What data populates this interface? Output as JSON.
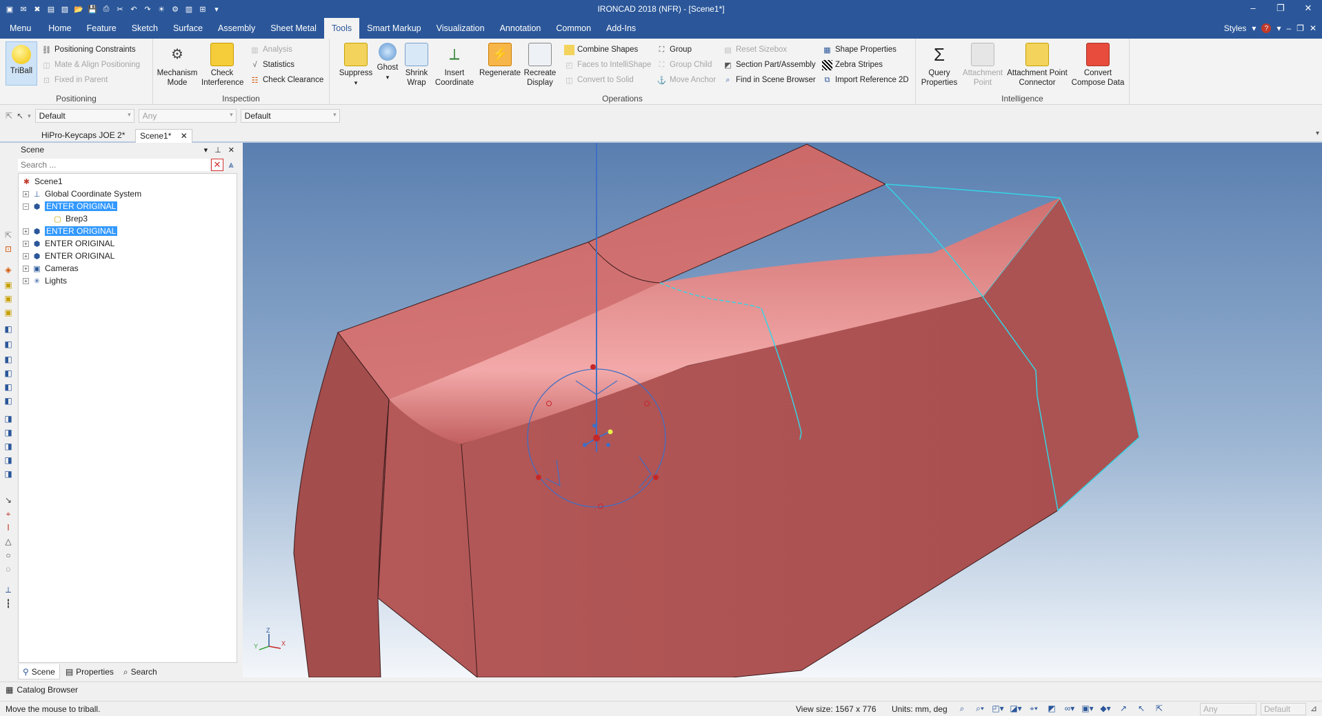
{
  "window": {
    "title": "IRONCAD 2018 (NFR) - [Scene1*]",
    "controls": [
      "–",
      "❐",
      "✕"
    ]
  },
  "quick_access": [
    "▣",
    "✉",
    "✖",
    "▤",
    "▧",
    "📂",
    "💾",
    "⎙",
    "✂",
    "↶",
    "↷",
    "☀",
    "⚙",
    "▥",
    "⊞",
    "▾"
  ],
  "ribbon_tabs": [
    "Menu",
    "Home",
    "Feature",
    "Sketch",
    "Surface",
    "Assembly",
    "Sheet Metal",
    "Tools",
    "Smart Markup",
    "Visualization",
    "Annotation",
    "Common",
    "Add-Ins"
  ],
  "active_tab": "Tools",
  "ribbon_right": {
    "styles": "Styles",
    "help": "?"
  },
  "ribbon": {
    "positioning": {
      "label": "Positioning",
      "triball": "TriBall",
      "positioning_constraints": "Positioning Constraints",
      "mate_align": "Mate & Align Positioning",
      "fixed_in_parent": "Fixed in Parent"
    },
    "inspection": {
      "label": "Inspection",
      "mechanism_mode": "Mechanism Mode",
      "check_interference": "Check Interference",
      "analysis": "Analysis",
      "statistics": "Statistics",
      "check_clearance": "Check Clearance"
    },
    "operations": {
      "label": "Operations",
      "suppress": "Suppress",
      "ghost": "Ghost",
      "shrink_wrap": "Shrink Wrap",
      "insert_coordinate": "Insert Coordinate",
      "regenerate": "Regenerate",
      "recreate_display": "Recreate Display",
      "combine_shapes": "Combine Shapes",
      "faces_to_intellishape": "Faces to IntelliShape",
      "convert_to_solid": "Convert to Solid",
      "group": "Group",
      "group_child": "Group Child",
      "move_anchor": "Move Anchor",
      "reset_sizebox": "Reset Sizebox",
      "section_part_assembly": "Section Part/Assembly",
      "find_in_scene_browser": "Find in Scene Browser",
      "shape_properties": "Shape Properties",
      "zebra_stripes": "Zebra Stripes",
      "import_reference_2d": "Import Reference 2D"
    },
    "intelligence": {
      "label": "Intelligence",
      "query_properties": "Query Properties",
      "attachment_point": "Attachment Point",
      "attachment_point_connector": "Attachment Point Connector",
      "convert_compose_data": "Convert Compose Data"
    }
  },
  "selector_bar": {
    "combo1": "Default",
    "combo2": "Any",
    "combo3": "Default"
  },
  "doc_tabs": [
    "HiPro-Keycaps JOE 2*",
    "Scene1*"
  ],
  "scene_panel": {
    "title": "Scene",
    "search_placeholder": "Search ...",
    "tree": [
      {
        "label": "Scene1",
        "level": 0,
        "expander": "",
        "icon": "✱",
        "selected": false
      },
      {
        "label": "Global Coordinate System",
        "level": 1,
        "expander": "+",
        "icon": "⊥",
        "selected": false
      },
      {
        "label": "ENTER ORIGINAL",
        "level": 1,
        "expander": "−",
        "icon": "⬢",
        "selected": true
      },
      {
        "label": "Brep3",
        "level": 2,
        "expander": "",
        "icon": "▢",
        "selected": false
      },
      {
        "label": "ENTER ORIGINAL",
        "level": 1,
        "expander": "+",
        "icon": "⬢",
        "selected": true
      },
      {
        "label": "ENTER ORIGINAL",
        "level": 1,
        "expander": "+",
        "icon": "⬢",
        "selected": false
      },
      {
        "label": "ENTER ORIGINAL",
        "level": 1,
        "expander": "+",
        "icon": "⬢",
        "selected": false
      },
      {
        "label": "Cameras",
        "level": 1,
        "expander": "+",
        "icon": "▣",
        "selected": false
      },
      {
        "label": "Lights",
        "level": 1,
        "expander": "+",
        "icon": "✳",
        "selected": false
      }
    ],
    "bottom_tabs": [
      "Scene",
      "Properties",
      "Search"
    ]
  },
  "catalog_browser": "Catalog Browser",
  "axis_labels": {
    "x": "X",
    "y": "Y",
    "z": "Z"
  },
  "status": {
    "message": "Move the mouse to triball.",
    "view_size": "View size: 1567 x 776",
    "units": "Units: mm, deg",
    "combo_any": "Any",
    "combo_default": "Default"
  },
  "colors": {
    "titlebar": "#2b579a",
    "part_face": "#b55a5a",
    "selected_edge": "#35d4e4",
    "selection_highlight": "#3399ff"
  }
}
